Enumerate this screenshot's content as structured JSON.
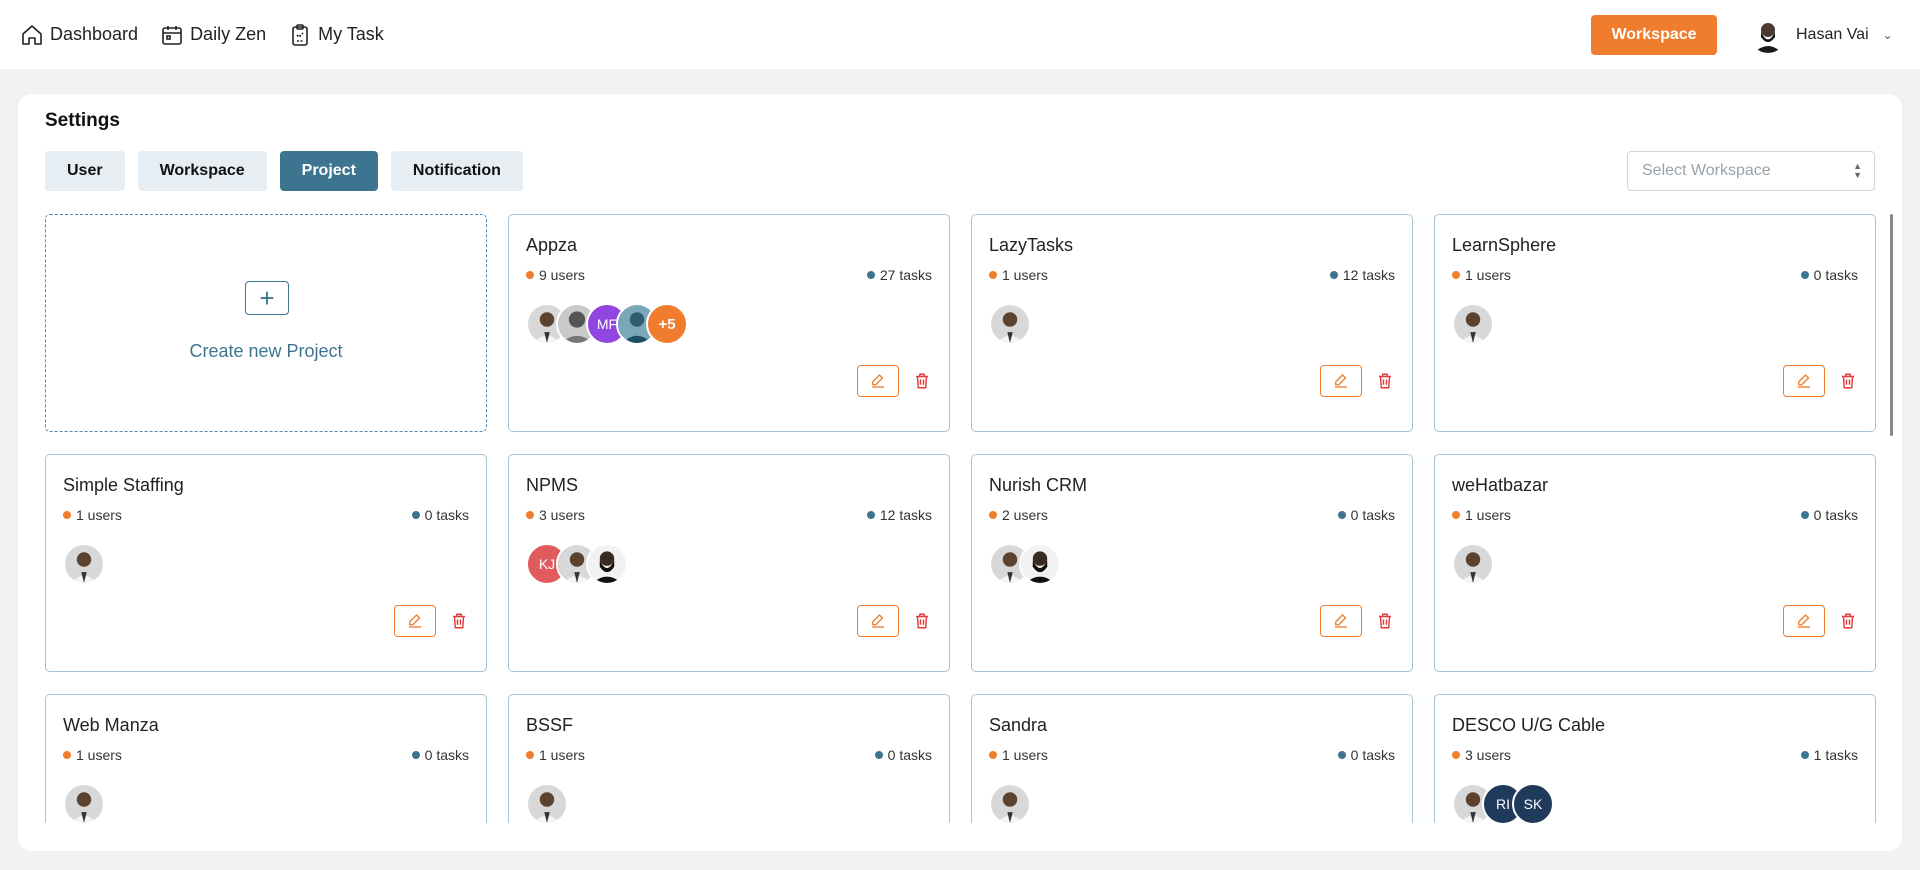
{
  "nav": {
    "links": [
      {
        "label": "Dashboard",
        "icon": "home-icon"
      },
      {
        "label": "Daily Zen",
        "icon": "calendar-icon"
      },
      {
        "label": "My Task",
        "icon": "clipboard-icon"
      }
    ],
    "workspace_button": "Workspace",
    "user_name": "Hasan Vai"
  },
  "settings": {
    "title": "Settings",
    "tabs": [
      {
        "label": "User",
        "active": false
      },
      {
        "label": "Workspace",
        "active": false
      },
      {
        "label": "Project",
        "active": true
      },
      {
        "label": "Notification",
        "active": false
      }
    ],
    "select_placeholder": "Select Workspace",
    "create_label": "Create new Project"
  },
  "colors": {
    "accent_orange": "#ef7d2d",
    "primary_teal": "#3d7590"
  },
  "projects": [
    {
      "name": "Appza",
      "users": "9 users",
      "tasks": "27 tasks",
      "avatars": [
        {
          "type": "photo"
        },
        {
          "type": "photo2"
        },
        {
          "type": "initials",
          "text": "MF",
          "color": "#9146e2"
        },
        {
          "type": "photo3"
        },
        {
          "type": "more",
          "text": "+5",
          "color": "#ef7d2d"
        }
      ]
    },
    {
      "name": "LazyTasks",
      "users": "1 users",
      "tasks": "12 tasks",
      "avatars": [
        {
          "type": "photo"
        }
      ]
    },
    {
      "name": "LearnSphere",
      "users": "1 users",
      "tasks": "0 tasks",
      "avatars": [
        {
          "type": "photo"
        }
      ]
    },
    {
      "name": "Simple Staffing",
      "users": "1 users",
      "tasks": "0 tasks",
      "avatars": [
        {
          "type": "photo"
        }
      ]
    },
    {
      "name": "NPMS",
      "users": "3 users",
      "tasks": "12 tasks",
      "avatars": [
        {
          "type": "initials",
          "text": "KJ",
          "color": "#e05a5e"
        },
        {
          "type": "photo"
        },
        {
          "type": "beard"
        }
      ]
    },
    {
      "name": "Nurish CRM",
      "users": "2 users",
      "tasks": "0 tasks",
      "avatars": [
        {
          "type": "photo"
        },
        {
          "type": "beard"
        }
      ]
    },
    {
      "name": "weHatbazar",
      "users": "1 users",
      "tasks": "0 tasks",
      "avatars": [
        {
          "type": "photo"
        }
      ]
    },
    {
      "name": "Web Manza",
      "users": "1 users",
      "tasks": "0 tasks",
      "avatars": [
        {
          "type": "photo"
        }
      ]
    },
    {
      "name": "BSSF",
      "users": "1 users",
      "tasks": "0 tasks",
      "avatars": [
        {
          "type": "photo"
        }
      ]
    },
    {
      "name": "Sandra",
      "users": "1 users",
      "tasks": "0 tasks",
      "avatars": [
        {
          "type": "photo"
        }
      ]
    },
    {
      "name": "DESCO U/G Cable",
      "users": "3 users",
      "tasks": "1 tasks",
      "avatars": [
        {
          "type": "photo"
        },
        {
          "type": "initials",
          "text": "RI",
          "color": "#1f3a5a"
        },
        {
          "type": "initials",
          "text": "SK",
          "color": "#1f3a5a"
        }
      ]
    }
  ]
}
